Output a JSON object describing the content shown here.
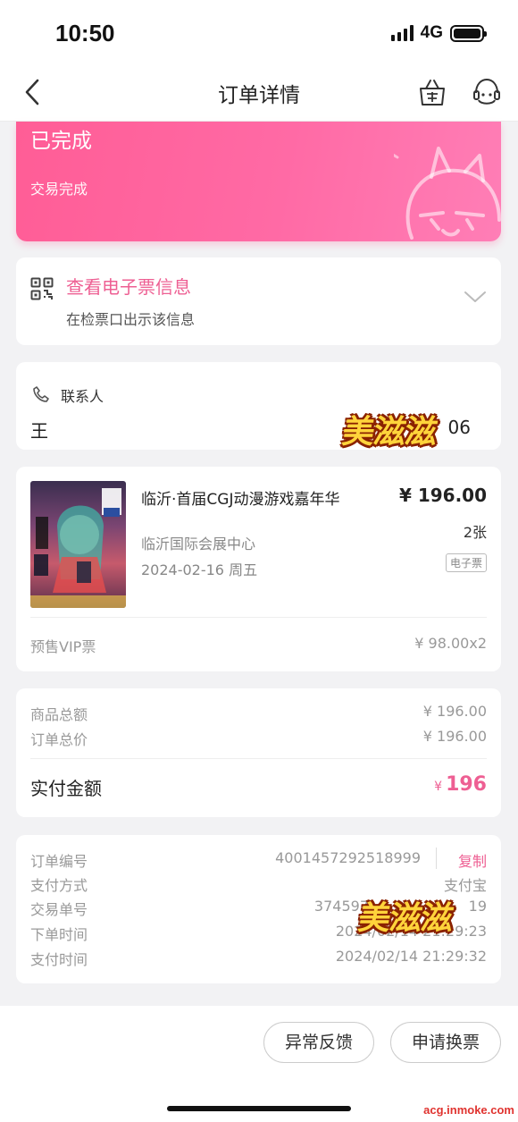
{
  "status_bar": {
    "time": "10:50",
    "network": "4G"
  },
  "nav": {
    "title": "订单详情"
  },
  "order_status": {
    "title": "已完成",
    "subtitle": "交易完成"
  },
  "e_ticket": {
    "title": "查看电子票信息",
    "subtitle": "在检票口出示该信息"
  },
  "contact": {
    "label": "联系人",
    "name": "王",
    "phone_tail": "06"
  },
  "watermark": {
    "text": "美滋滋"
  },
  "product": {
    "name": "临沂·首届CGJ动漫游戏嘉年华",
    "price": "¥ 196.00",
    "quantity": "2张",
    "venue": "临沂国际会展中心",
    "date": "2024-02-16 周五",
    "badge": "电子票",
    "ticket_type": "预售VIP票",
    "unit_price": "¥ 98.00x2"
  },
  "amounts": {
    "goods_total_label": "商品总额",
    "goods_total_value": "¥ 196.00",
    "order_total_label": "订单总价",
    "order_total_value": "¥ 196.00",
    "paid_label": "实付金额",
    "paid_currency": "¥",
    "paid_value": "196"
  },
  "order_info": {
    "order_no_label": "订单编号",
    "order_no": "4001457292518999",
    "copy_label": "复制",
    "pay_method_label": "支付方式",
    "pay_method": "支付宝",
    "trade_no_label": "交易单号",
    "trade_no_head": "374597",
    "trade_no_tail": "19",
    "order_time_label": "下单时间",
    "order_time": "2024/02/14 21:29:23",
    "pay_time_label": "支付时间",
    "pay_time": "2024/02/14 21:29:32"
  },
  "actions": {
    "feedback": "异常反馈",
    "exchange": "申请换票"
  },
  "site": "acg.inmoke.com",
  "colors": {
    "accent": "#ee5f93",
    "card_gradient_start": "#ff5d96",
    "card_gradient_end": "#ff7eb6"
  }
}
